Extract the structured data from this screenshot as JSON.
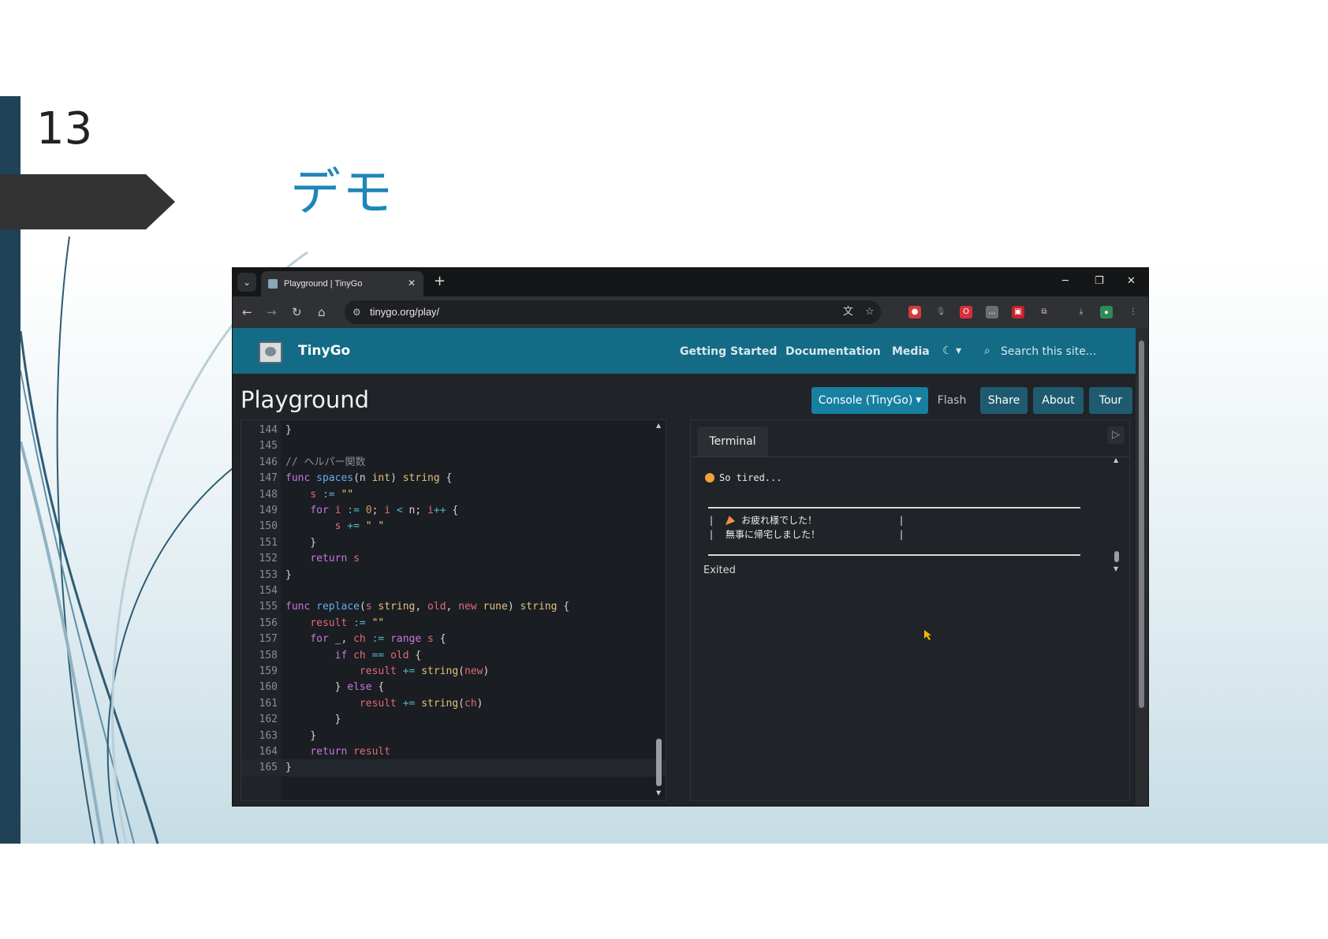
{
  "slide": {
    "number": "13",
    "title": "デモ"
  },
  "browser": {
    "tab_title": "Playground | TinyGo",
    "url": "tinygo.org/play/",
    "icons": {
      "tab_search": "chevron-down-icon",
      "tab_close": "close-icon",
      "new_tab": "plus-icon",
      "back": "arrow-left-icon",
      "forward": "arrow-right-icon",
      "reload": "reload-icon",
      "home": "home-icon",
      "site_info": "tune-icon",
      "translate": "translate-icon",
      "bookmark": "star-icon",
      "extensions": "puzzle-icon",
      "downloads": "download-icon",
      "menu": "kebab-menu-icon"
    }
  },
  "site": {
    "brand": "TinyGo",
    "nav": [
      "Getting Started",
      "Documentation",
      "Media"
    ],
    "search_placeholder": "Search this site..."
  },
  "playground": {
    "title": "Playground",
    "buttons": {
      "console": "Console (TinyGo)",
      "flash": "Flash",
      "share": "Share",
      "about": "About",
      "tour": "Tour"
    }
  },
  "editor": {
    "lines": [
      {
        "n": "144",
        "code": "}"
      },
      {
        "n": "145",
        "code": ""
      },
      {
        "n": "146",
        "code": "// ヘルパー関数"
      },
      {
        "n": "147",
        "code": "func spaces(n int) string {"
      },
      {
        "n": "148",
        "code": "    s := \"\""
      },
      {
        "n": "149",
        "code": "    for i := 0; i < n; i++ {"
      },
      {
        "n": "150",
        "code": "        s += \" \""
      },
      {
        "n": "151",
        "code": "    }"
      },
      {
        "n": "152",
        "code": "    return s"
      },
      {
        "n": "153",
        "code": "}"
      },
      {
        "n": "154",
        "code": ""
      },
      {
        "n": "155",
        "code": "func replace(s string, old, new rune) string {"
      },
      {
        "n": "156",
        "code": "    result := \"\""
      },
      {
        "n": "157",
        "code": "    for _, ch := range s {"
      },
      {
        "n": "158",
        "code": "        if ch == old {"
      },
      {
        "n": "159",
        "code": "            result += string(new)"
      },
      {
        "n": "160",
        "code": "        } else {"
      },
      {
        "n": "161",
        "code": "            result += string(ch)"
      },
      {
        "n": "162",
        "code": "        }"
      },
      {
        "n": "163",
        "code": "    }"
      },
      {
        "n": "164",
        "code": "    return result"
      },
      {
        "n": "165",
        "code": "}"
      }
    ]
  },
  "terminal": {
    "tab": "Terminal",
    "line1": "So tired...",
    "box_line1": "お疲れ様でした！",
    "box_line2": "無事に帰宅しました！",
    "status": "Exited"
  },
  "colors": {
    "nav_bg": "#136b86",
    "primary_button": "#1780a0",
    "slide_title": "#1f86b8",
    "left_bar": "#1f4257"
  }
}
